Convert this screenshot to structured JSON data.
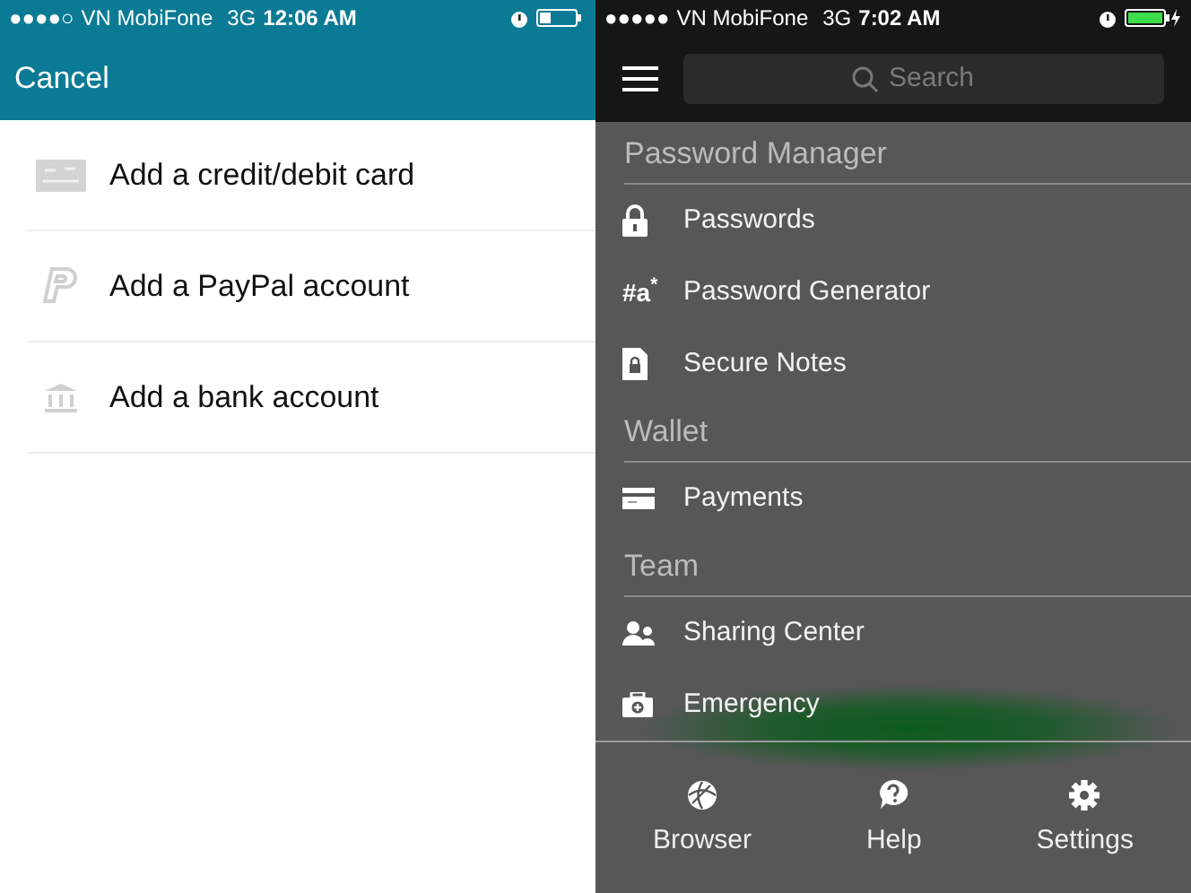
{
  "left_screen": {
    "status_bar": {
      "signal": "●●●●○",
      "carrier": "VN MobiFone",
      "network": "3G",
      "time": "12:06 AM",
      "charging": false
    },
    "nav": {
      "cancel": "Cancel"
    },
    "options": [
      {
        "kind": "card",
        "label": "Add a credit/debit card"
      },
      {
        "kind": "paypal",
        "label": "Add a PayPal account"
      },
      {
        "kind": "bank",
        "label": "Add a bank account"
      }
    ]
  },
  "right_screen": {
    "status_bar": {
      "signal": "●●●●●",
      "carrier": "VN MobiFone",
      "network": "3G",
      "time": "7:02 AM",
      "charging": true
    },
    "search": {
      "placeholder": "Search"
    },
    "sections": [
      {
        "title": "Password Manager",
        "items": [
          {
            "kind": "lock",
            "label": "Passwords"
          },
          {
            "kind": "generator",
            "icon_text": "#a$^{*}$",
            "label": "Password Generator"
          },
          {
            "kind": "note",
            "label": "Secure Notes"
          }
        ]
      },
      {
        "title": "Wallet",
        "items": [
          {
            "kind": "card",
            "label": "Payments"
          }
        ]
      },
      {
        "title": "Team",
        "items": [
          {
            "kind": "people",
            "label": "Sharing Center"
          },
          {
            "kind": "medkit",
            "label": "Emergency"
          }
        ]
      }
    ],
    "footer": [
      {
        "kind": "globe",
        "label": "Browser"
      },
      {
        "kind": "help",
        "label": "Help"
      },
      {
        "kind": "gear",
        "label": "Settings"
      }
    ]
  }
}
